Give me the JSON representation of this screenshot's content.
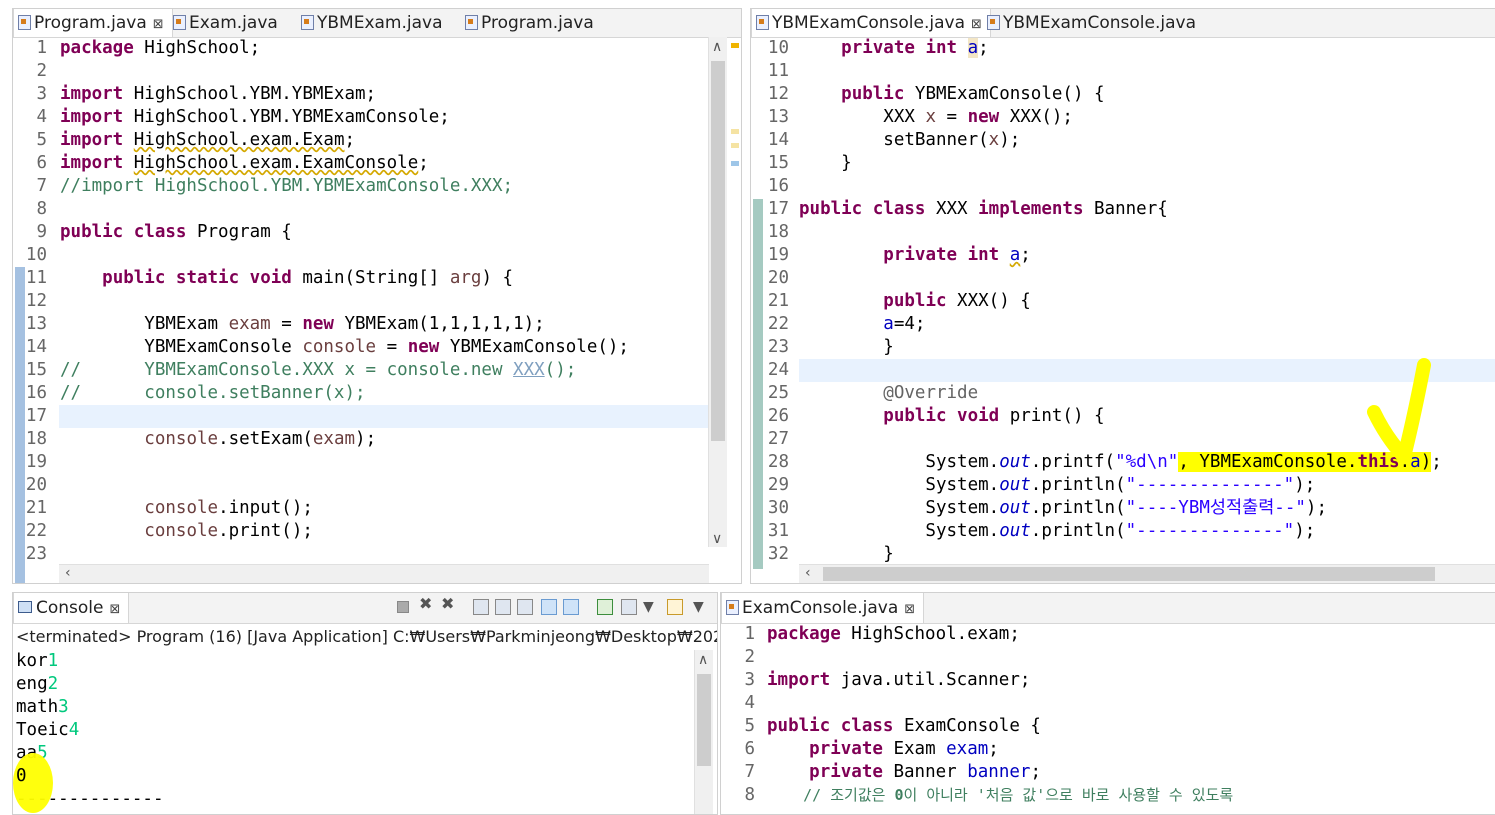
{
  "left_editor": {
    "tabs": [
      {
        "label": "Program.java",
        "close": "⊠"
      },
      {
        "label": "Exam.java"
      },
      {
        "label": "YBMExam.java"
      },
      {
        "label": "Program.java"
      }
    ],
    "line_numbers": [
      "1",
      "2",
      "3",
      "4",
      "5",
      "6",
      "7",
      "8",
      "9",
      "10",
      "11",
      "12",
      "13",
      "14",
      "15",
      "16",
      "17",
      "18",
      "19",
      "20",
      "21",
      "22",
      "23"
    ]
  },
  "right_editor": {
    "tabs": [
      {
        "label": "YBMExamConsole.java",
        "close": "⊠"
      },
      {
        "label": "YBMExamConsole.java"
      }
    ],
    "line_numbers": [
      "10",
      "11",
      "12",
      "13",
      "14",
      "15",
      "16",
      "17",
      "18",
      "19",
      "20",
      "21",
      "22",
      "23",
      "24",
      "25",
      "26",
      "27",
      "28",
      "29",
      "30",
      "31",
      "32"
    ]
  },
  "console": {
    "tab_label": "Console",
    "close": "⊠",
    "status": "<terminated> Program (16) [Java Application] C:₩Users₩Parkminjeong₩Desktop₩202",
    "output": [
      {
        "text": "kor",
        "input": "1"
      },
      {
        "text": "eng",
        "input": "2"
      },
      {
        "text": "math",
        "input": "3"
      },
      {
        "text": "Toeic",
        "input": "4"
      },
      {
        "text": "aa",
        "input": "5"
      },
      {
        "text": "0",
        "input": ""
      },
      {
        "text": "--------------",
        "input": ""
      }
    ]
  },
  "exam_console": {
    "tab_label": "ExamConsole.java",
    "close": "⊠",
    "line_numbers": [
      "1",
      "2",
      "3",
      "4",
      "5",
      "6",
      "7",
      "8"
    ]
  },
  "colors": {
    "keyword": "#7f0055",
    "comment": "#3f7f5f",
    "string": "#2a00ff",
    "field": "#0000c0",
    "highlight": "#ffff00",
    "current_line": "#e8f2fe",
    "console_input": "#00c87d"
  }
}
